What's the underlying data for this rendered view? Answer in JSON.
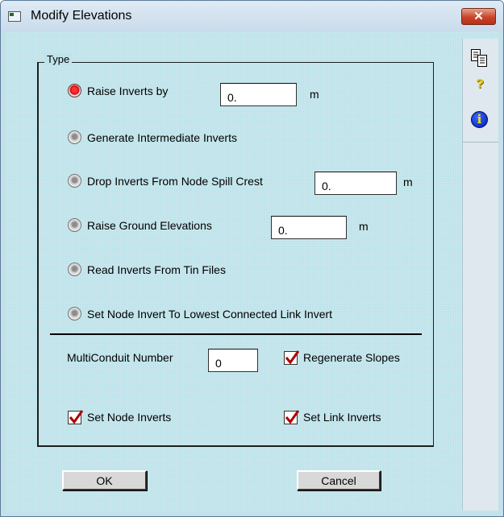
{
  "window": {
    "title": "Modify Elevations",
    "close_glyph": "✕"
  },
  "group": {
    "legend": "Type"
  },
  "options": [
    {
      "label": "Raise Inverts by",
      "selected": true,
      "value": "0.",
      "unit": "m"
    },
    {
      "label": "Generate Intermediate Inverts",
      "selected": false
    },
    {
      "label": "Drop Inverts From Node Spill Crest",
      "selected": false,
      "value": "0.",
      "unit": "m"
    },
    {
      "label": "Raise Ground Elevations",
      "selected": false,
      "value": "0.",
      "unit": "m"
    },
    {
      "label": "Read Inverts From Tin Files",
      "selected": false
    },
    {
      "label": "Set Node Invert To Lowest Connected Link Invert",
      "selected": false
    }
  ],
  "multiconduit": {
    "label": "MultiConduit Number",
    "value": "0"
  },
  "checkboxes": {
    "regenerate_slopes": {
      "label": "Regenerate Slopes",
      "checked": true
    },
    "set_node_inverts": {
      "label": "Set Node Inverts",
      "checked": true
    },
    "set_link_inverts": {
      "label": "Set Link Inverts",
      "checked": true
    }
  },
  "buttons": {
    "ok": "OK",
    "cancel": "Cancel"
  },
  "side_toolbar": {
    "icons": [
      "copy-icon",
      "help-icon",
      "info-icon"
    ],
    "help_glyph": "?",
    "info_glyph": "i"
  },
  "colors": {
    "dialog_background": "#bfe3ea",
    "radio_selected": "#c60000",
    "checkmark": "#b00000",
    "close_button": "#c8442a"
  }
}
